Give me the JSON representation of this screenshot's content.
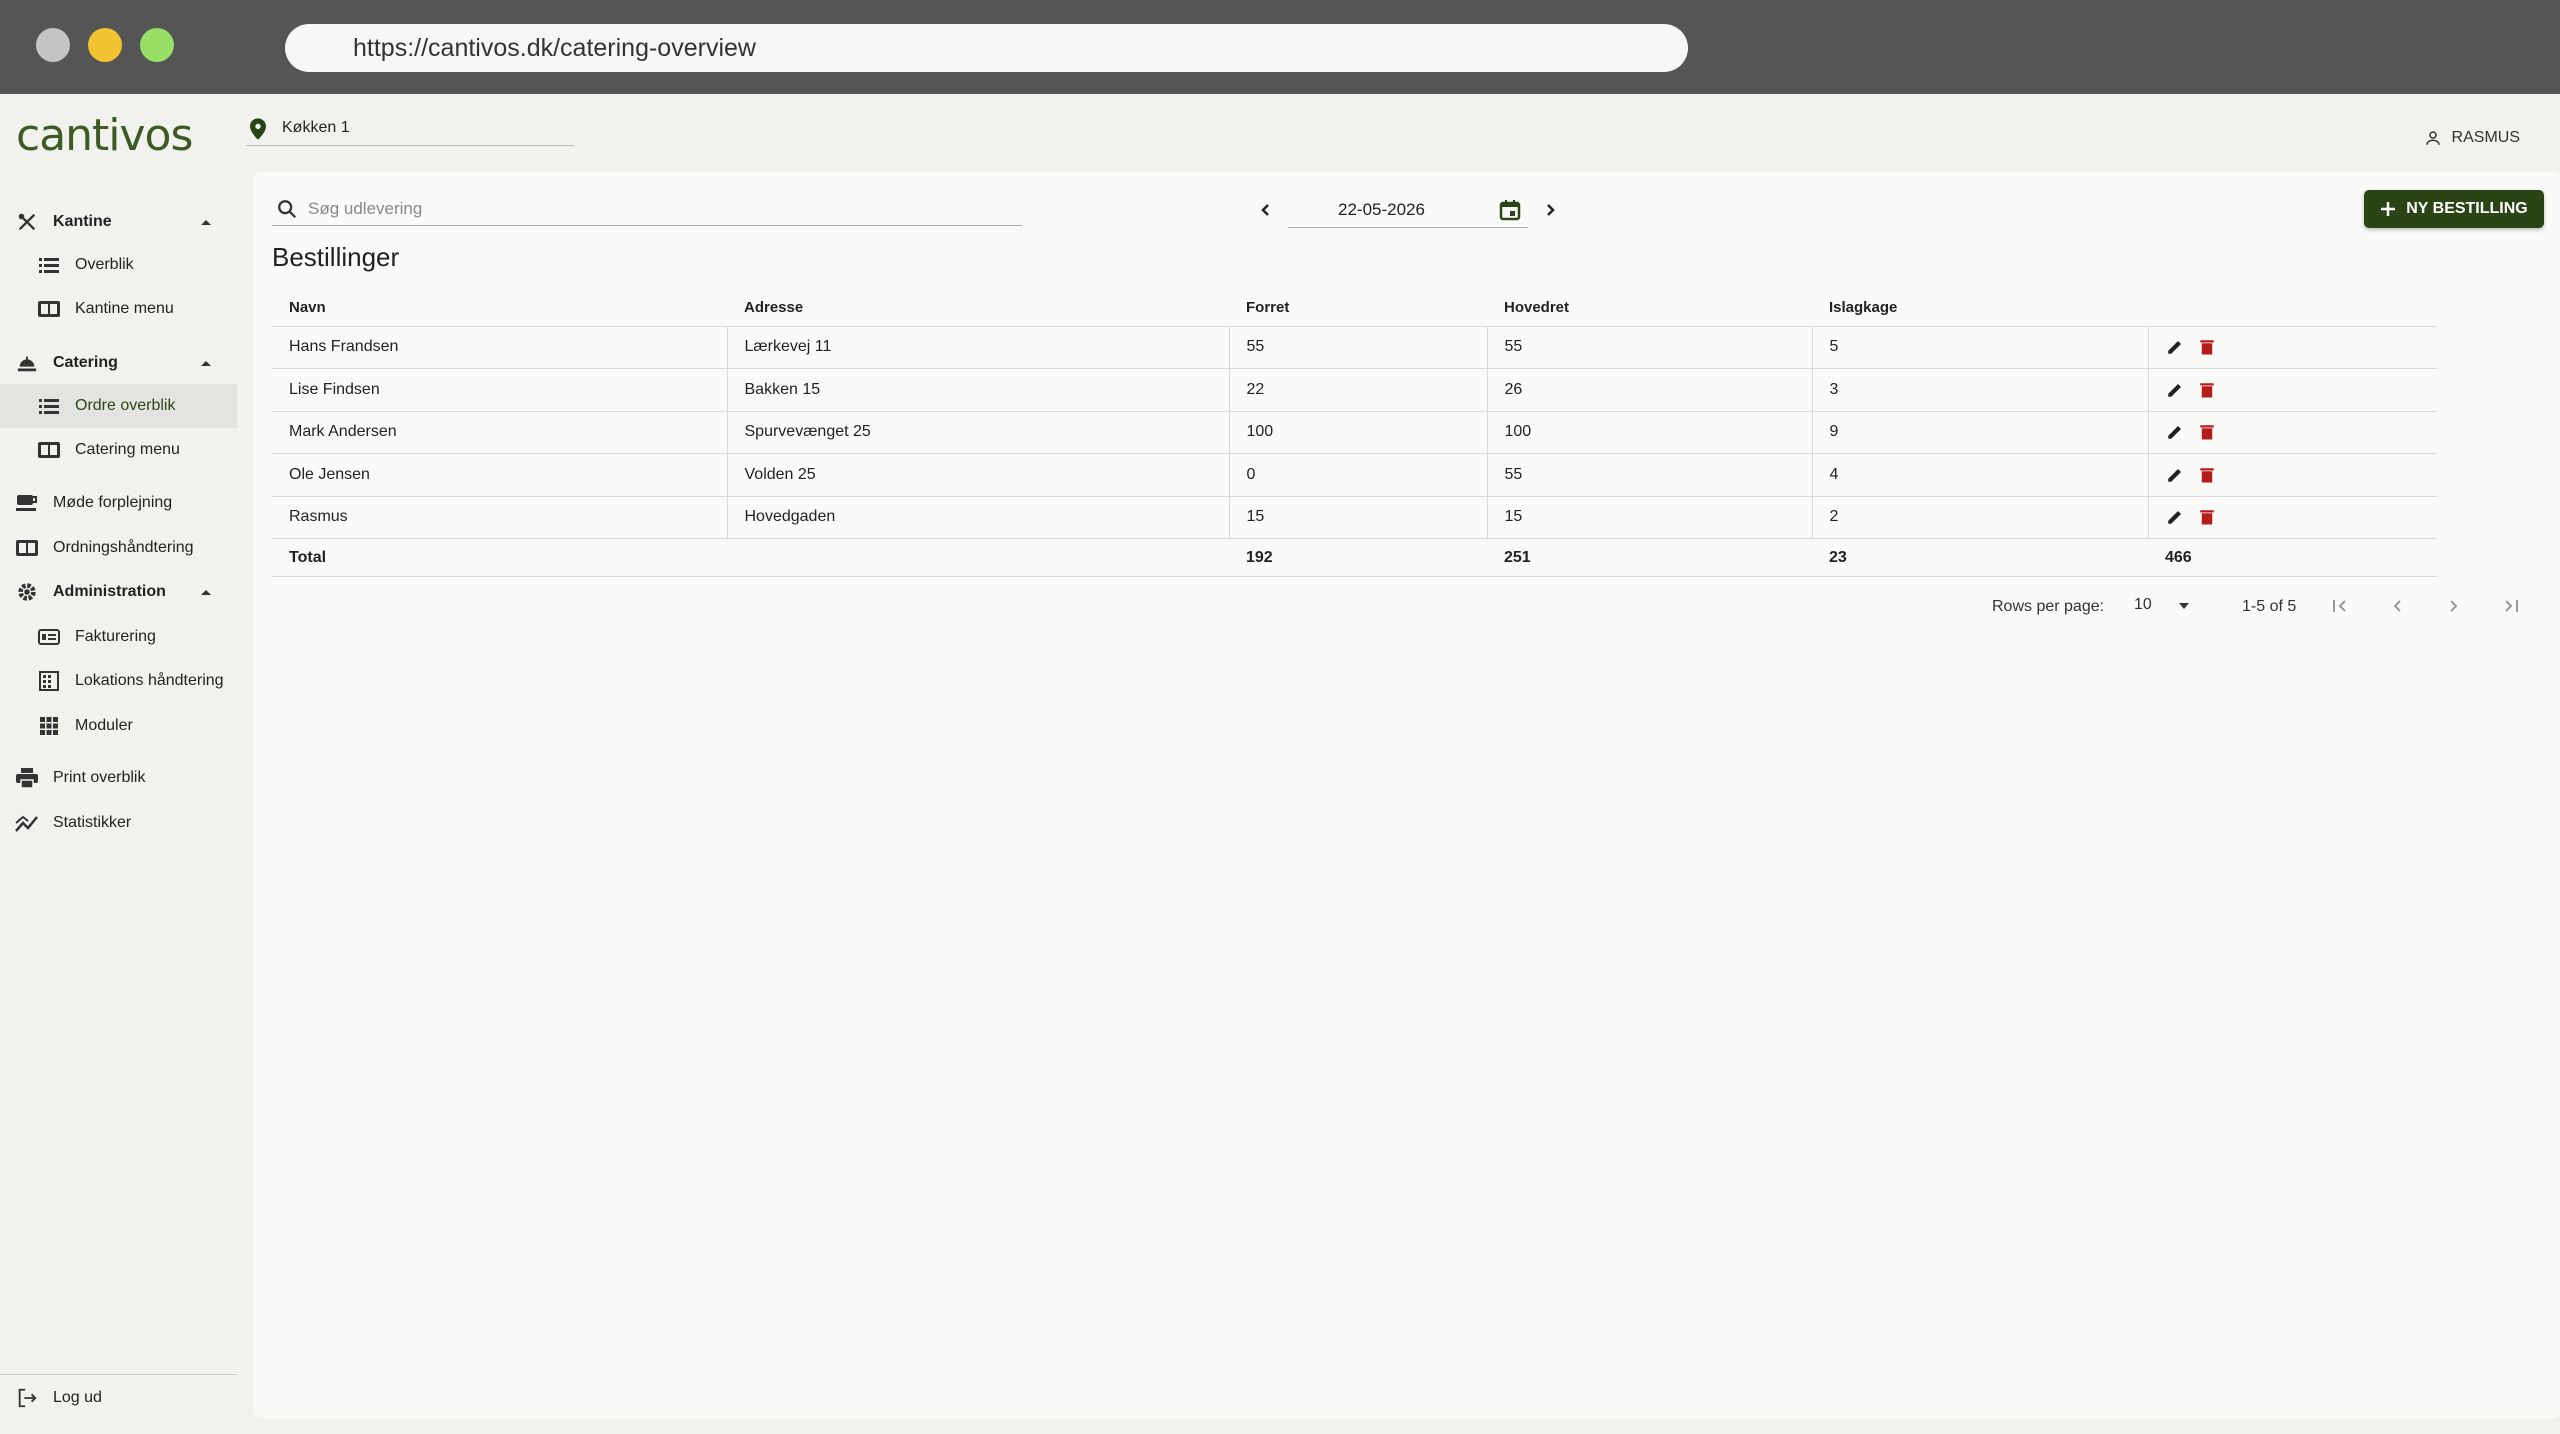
{
  "browser": {
    "url": "https://cantivos.dk/catering-overview"
  },
  "brand": {
    "logo_text": "cantivos",
    "accent": "#2b4416"
  },
  "header": {
    "location": "Køkken 1",
    "user": "RASMUS"
  },
  "sidebar": {
    "items": [
      {
        "label": "Kantine"
      },
      {
        "label": "Overblik"
      },
      {
        "label": "Kantine menu"
      },
      {
        "label": "Catering"
      },
      {
        "label": "Ordre overblik"
      },
      {
        "label": "Catering menu"
      },
      {
        "label": "Møde forplejning"
      },
      {
        "label": "Ordningshåndtering"
      },
      {
        "label": "Administration"
      },
      {
        "label": "Fakturering"
      },
      {
        "label": "Lokations håndtering"
      },
      {
        "label": "Moduler"
      },
      {
        "label": "Print overblik"
      },
      {
        "label": "Statistikker"
      }
    ],
    "logout": "Log ud"
  },
  "toolbar": {
    "search_placeholder": "Søg udlevering",
    "date": "22-05-2026",
    "new_button": "NY BESTILLING"
  },
  "main": {
    "title": "Bestillinger",
    "columns": [
      "Navn",
      "Adresse",
      "Forret",
      "Hovedret",
      "Islagkage"
    ],
    "rows": [
      {
        "name": "Hans Frandsen",
        "address": "Lærkevej 11",
        "forret": "55",
        "hovedret": "55",
        "islagkage": "5"
      },
      {
        "name": "Lise Findsen",
        "address": "Bakken 15",
        "forret": "22",
        "hovedret": "26",
        "islagkage": "3"
      },
      {
        "name": "Mark Andersen",
        "address": "Spurvevænget 25",
        "forret": "100",
        "hovedret": "100",
        "islagkage": "9"
      },
      {
        "name": "Ole Jensen",
        "address": "Volden 25",
        "forret": "0",
        "hovedret": "55",
        "islagkage": "4"
      },
      {
        "name": "Rasmus",
        "address": "Hovedgaden",
        "forret": "15",
        "hovedret": "15",
        "islagkage": "2"
      }
    ],
    "total": {
      "label": "Total",
      "forret": "192",
      "hovedret": "251",
      "islagkage": "23",
      "sum": "466"
    }
  },
  "pagination": {
    "rows_per_page_label": "Rows per page:",
    "rows_per_page": "10",
    "range": "1-5 of 5"
  }
}
